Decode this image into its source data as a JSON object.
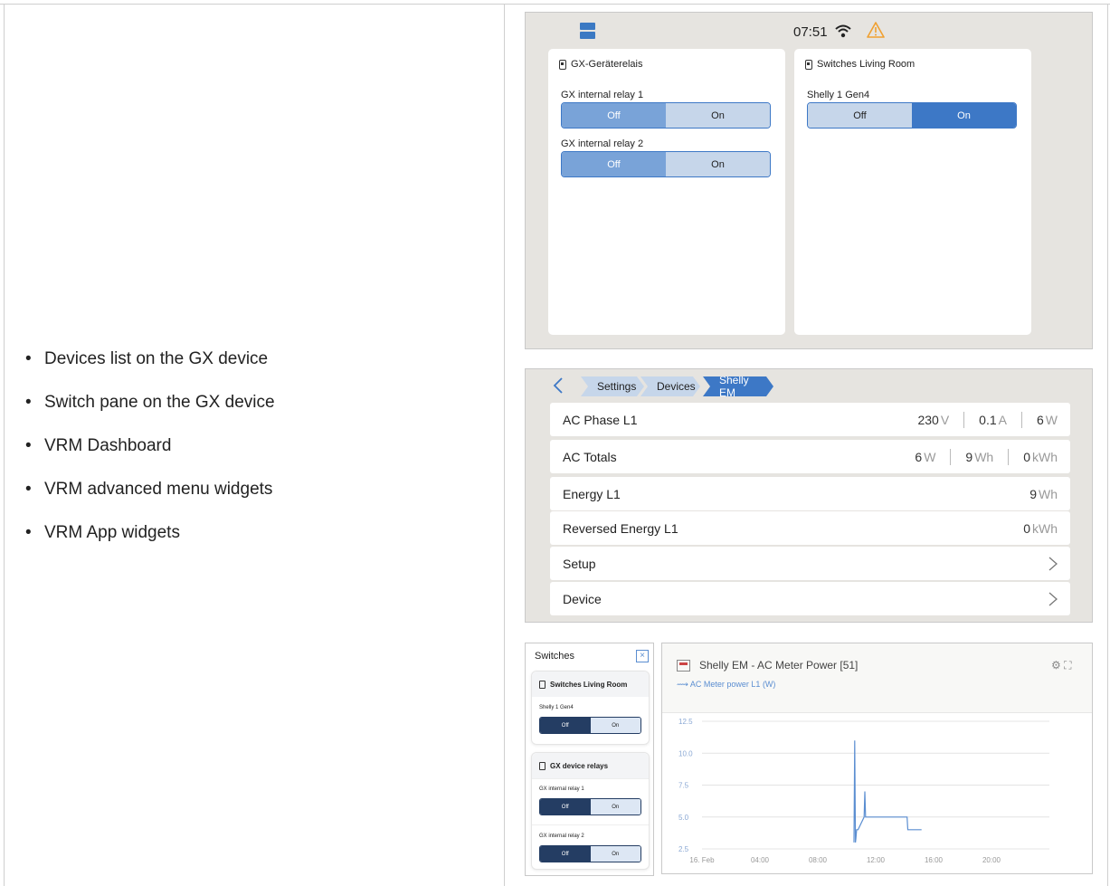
{
  "bullets": [
    "Devices list on the GX device",
    "Switch pane on the GX device",
    "VRM Dashboard",
    "VRM advanced menu widgets",
    "VRM App widgets"
  ],
  "gx_switch_pane": {
    "clock": "07:51",
    "status_icons": [
      "pages-icon",
      "wifi-icon",
      "warning-icon"
    ],
    "cards": [
      {
        "title": "GX-Geräterelais",
        "switches": [
          {
            "label": "GX internal relay 1",
            "off": "Off",
            "on": "On",
            "state": "off"
          },
          {
            "label": "GX internal relay 2",
            "off": "Off",
            "on": "On",
            "state": "off"
          }
        ]
      },
      {
        "title": "Switches Living Room",
        "switches": [
          {
            "label": "Shelly 1 Gen4",
            "off": "Off",
            "on": "On",
            "state": "on"
          }
        ]
      }
    ]
  },
  "gx_device_page": {
    "breadcrumb": [
      "Settings",
      "Devices",
      "Shelly EM"
    ],
    "rows": [
      {
        "name": "AC Phase L1",
        "values": [
          {
            "v": "230",
            "u": "V"
          },
          {
            "v": "0.1",
            "u": "A"
          },
          {
            "v": "6",
            "u": "W"
          }
        ]
      },
      {
        "name": "AC Totals",
        "values": [
          {
            "v": "6",
            "u": "W"
          },
          {
            "v": "9",
            "u": "Wh"
          },
          {
            "v": "0",
            "u": "kWh"
          }
        ]
      },
      {
        "name": "Energy L1",
        "values": [
          {
            "v": "9",
            "u": "Wh"
          }
        ]
      },
      {
        "name": "Reversed Energy L1",
        "values": [
          {
            "v": "0",
            "u": "kWh"
          }
        ]
      },
      {
        "name": "Setup",
        "values": []
      },
      {
        "name": "Device",
        "values": []
      }
    ]
  },
  "vrm_sidebar": {
    "title": "Switches",
    "close": "×",
    "cards": [
      {
        "title": "Switches Living Room",
        "switches": [
          {
            "label": "Shelly 1 Gen4",
            "off": "Off",
            "on": "On"
          }
        ]
      },
      {
        "title": "GX device relays",
        "switches": [
          {
            "label": "GX internal relay 1",
            "off": "Off",
            "on": "On"
          },
          {
            "label": "GX internal relay 2",
            "off": "Off",
            "on": "On"
          }
        ]
      }
    ]
  },
  "vrm_widget": {
    "title": "Shelly EM - AC Meter Power [51]",
    "legend": "⟿ AC Meter power L1 (W)",
    "tools": "⚙ ⛶",
    "series_color": "#5b8ed1"
  },
  "chart_data": {
    "type": "line",
    "title": "Shelly EM - AC Meter Power [51]",
    "xlabel": "",
    "ylabel": "",
    "x_ticks": [
      "16. Feb",
      "04:00",
      "08:00",
      "12:00",
      "16:00",
      "20:00"
    ],
    "y_ticks": [
      "12.5",
      "10.0",
      "7.5",
      "5.0",
      "2.5"
    ],
    "ylim": [
      2.5,
      12.5
    ],
    "grid": true,
    "series": [
      {
        "name": "AC Meter power L1 (W)",
        "x": [
          "10:30",
          "10:33",
          "10:36",
          "10:38",
          "10:41",
          "10:44",
          "10:47",
          "11:12",
          "11:15",
          "11:18",
          "11:20",
          "14:10",
          "14:13",
          "15:10"
        ],
        "y": [
          3.0,
          11.0,
          3.0,
          3.3,
          4.0,
          4.0,
          4.0,
          5.0,
          7.0,
          5.0,
          5.0,
          5.0,
          4.0,
          4.0
        ]
      }
    ]
  }
}
